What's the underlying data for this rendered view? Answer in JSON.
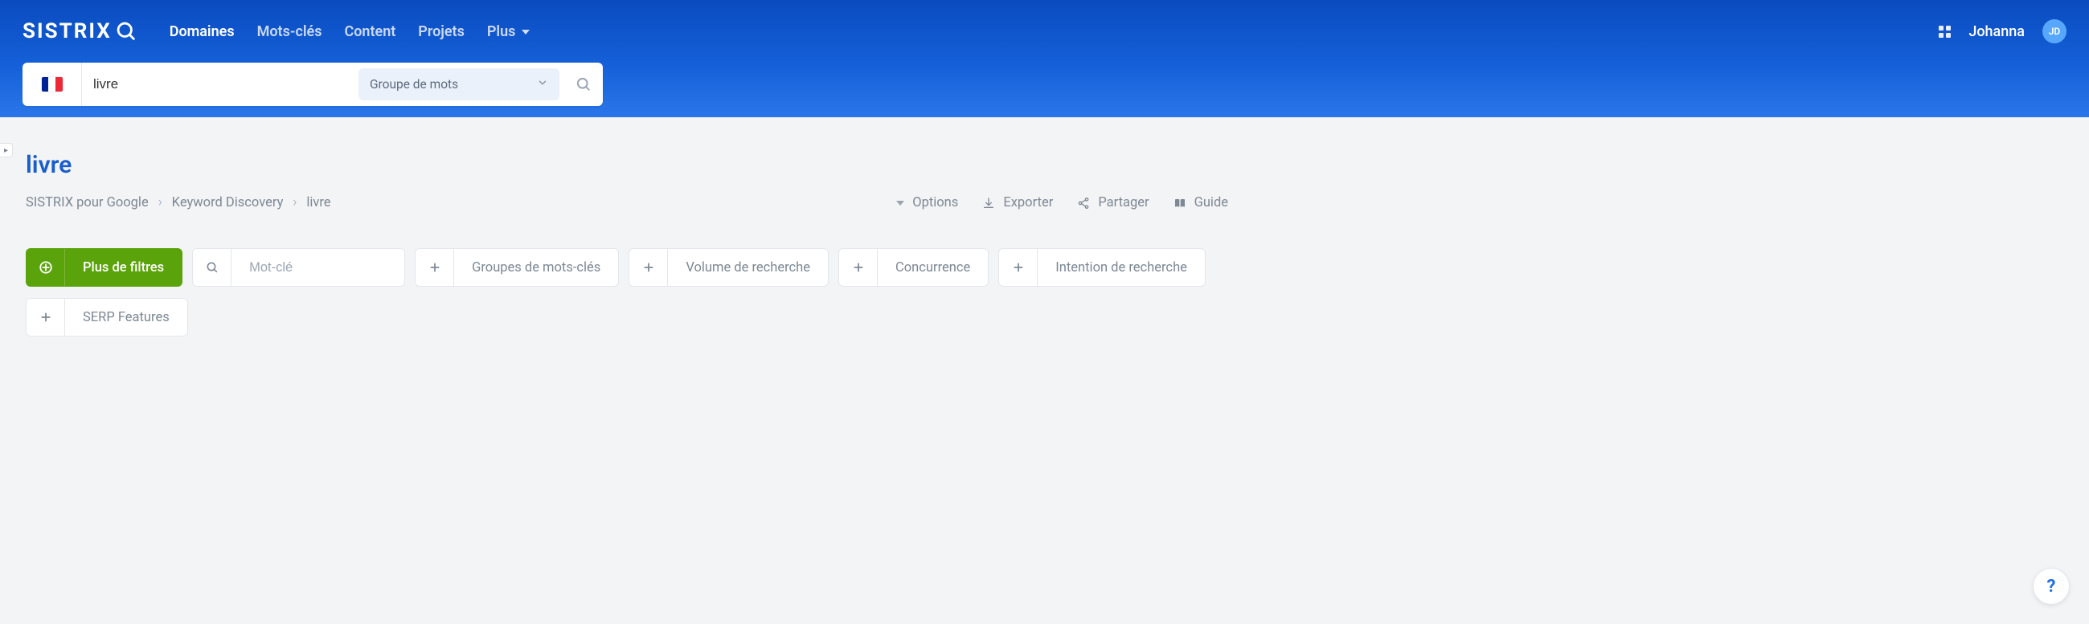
{
  "brand": {
    "name": "SISTRIX"
  },
  "nav": {
    "items": [
      {
        "label": "Domaines",
        "active": true,
        "has_dropdown": false
      },
      {
        "label": "Mots-clés",
        "active": false,
        "has_dropdown": false
      },
      {
        "label": "Content",
        "active": false,
        "has_dropdown": false
      },
      {
        "label": "Projets",
        "active": false,
        "has_dropdown": false
      },
      {
        "label": "Plus",
        "active": false,
        "has_dropdown": true
      }
    ]
  },
  "user": {
    "name": "Johanna",
    "initials": "JD"
  },
  "search": {
    "country_flag": "fr",
    "value": "livre",
    "mode_label": "Groupe de mots"
  },
  "page": {
    "title": "livre"
  },
  "breadcrumb": {
    "items": [
      "SISTRIX pour Google",
      "Keyword Discovery",
      "livre"
    ]
  },
  "actions": {
    "options": "Options",
    "export": "Exporter",
    "share": "Partager",
    "guide": "Guide"
  },
  "filters": {
    "more_label": "Plus de filtres",
    "keyword_placeholder": "Mot-clé",
    "row1": [
      "Groupes de mots-clés",
      "Volume de recherche",
      "Concurrence",
      "Intention de recherche"
    ],
    "row2": [
      "SERP Features"
    ]
  },
  "help": {
    "label": "?"
  }
}
